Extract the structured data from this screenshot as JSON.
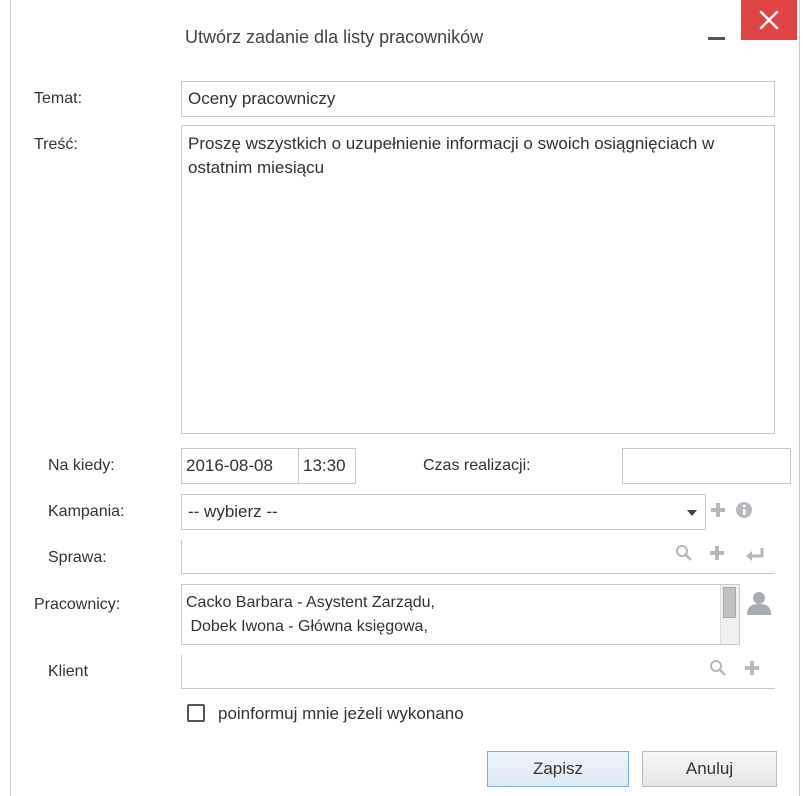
{
  "dialog": {
    "title": "Utwórz zadanie dla listy pracowników"
  },
  "form": {
    "temat_label": "Temat:",
    "temat_value": "Oceny pracowniczy",
    "tresc_label": "Treść:",
    "tresc_value": "Proszę wszystkich o uzupełnienie informacji o swoich osiągnięciach w ostatnim miesiącu",
    "na_kiedy_label": "Na kiedy:",
    "date_value": "2016-08-08",
    "time_value": "13:30",
    "czas_label": "Czas realizacji:",
    "czas_value": "",
    "kampania_label": "Kampania:",
    "kampania_value": "-- wybierz --",
    "sprawa_label": "Sprawa:",
    "pracownicy_label": "Pracownicy:",
    "pracownicy": [
      "Cacko Barbara - Asystent Zarządu,",
      " Dobek Iwona - Główna księgowa,"
    ],
    "klient_label": "Klient",
    "notify_label": "poinformuj mnie jeżeli wykonano"
  },
  "buttons": {
    "save": "Zapisz",
    "cancel": "Anuluj"
  },
  "colors": {
    "close_bg": "#e04343",
    "icon_gray": "#b5b9bd",
    "accent_border": "#7faed6"
  }
}
